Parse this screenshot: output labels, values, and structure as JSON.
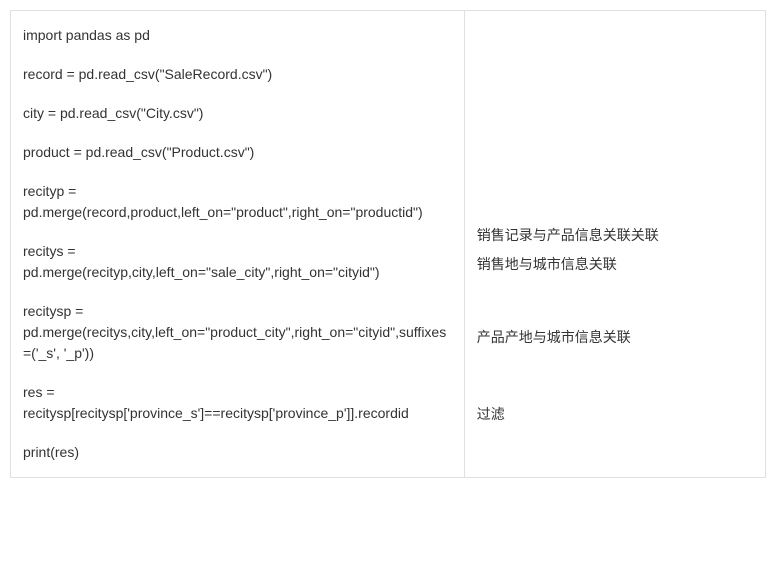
{
  "code": {
    "line1": "import pandas as pd",
    "line2": "record = pd.read_csv(\"SaleRecord.csv\")",
    "line3": "city = pd.read_csv(\"City.csv\")",
    "line4": "product = pd.read_csv(\"Product.csv\")",
    "line5a": "recityp =",
    "line5b": "pd.merge(record,product,left_on=\"product\",right_on=\"productid\")",
    "line6a": "recitys =",
    "line6b": "pd.merge(recityp,city,left_on=\"sale_city\",right_on=\"cityid\")",
    "line7a": "recitysp =",
    "line7b": "pd.merge(recitys,city,left_on=\"product_city\",right_on=\"cityid\",suffixes=('_s',   '_p'))",
    "line8a": "res =",
    "line8b": "recitysp[recitysp['province_s']==recitysp['province_p']].recordid",
    "line9": "print(res)"
  },
  "comments": {
    "c1": "销售记录与产品信息关联关联",
    "c2": "销售地与城市信息关联",
    "c3": "产品产地与城市信息关联",
    "c4": "过滤"
  }
}
